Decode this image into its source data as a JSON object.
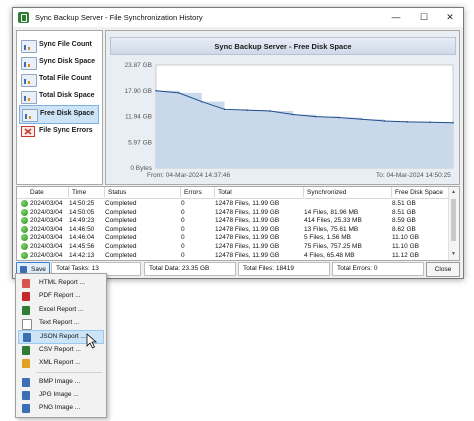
{
  "window": {
    "title": "Sync Backup Server - File Synchronization History",
    "controls": [
      "—",
      "☐",
      "✕"
    ]
  },
  "sidebar": {
    "items": [
      {
        "label": "Sync File Count",
        "icon": "chart-icon",
        "active": false
      },
      {
        "label": "Sync Disk Space",
        "icon": "chart-icon",
        "active": false
      },
      {
        "label": "Total File Count",
        "icon": "chart-icon",
        "active": false
      },
      {
        "label": "Total Disk Space",
        "icon": "chart-icon",
        "active": false
      },
      {
        "label": "Free Disk Space",
        "icon": "chart-icon",
        "active": true
      },
      {
        "label": "File Sync Errors",
        "icon": "error-icon",
        "active": false
      }
    ]
  },
  "chart": {
    "title": "Sync Backup Server - Free Disk Space",
    "from_label": "From: 04-Mar-2024 14:37:46",
    "to_label": "To: 04-Mar-2024 14:50:25"
  },
  "chart_data": {
    "type": "area",
    "title": "Sync Backup Server - Free Disk Space",
    "y_ticks": [
      "23.87 GB",
      "17.90 GB",
      "11.94 GB",
      "5.97 GB",
      "0 Bytes"
    ],
    "ylim": [
      0,
      23.87
    ],
    "x_start": "04-Mar-2024 14:37:46",
    "x_end": "04-Mar-2024 14:50:25",
    "grid": false,
    "values": [
      17.9,
      17.4,
      15.4,
      13.6,
      13.4,
      13.2,
      12.4,
      11.9,
      11.7,
      11.3,
      10.9,
      10.7,
      10.6,
      10.5
    ]
  },
  "table": {
    "columns": [
      "Date",
      "Time",
      "Status",
      "Errors",
      "Total",
      "Synchronized",
      "Free Disk Space"
    ],
    "rows": [
      [
        "2024/03/04",
        "14:50:25",
        "Completed",
        "0",
        "12478 Files, 11.99 GB",
        "",
        "8.51 GB"
      ],
      [
        "2024/03/04",
        "14:50:05",
        "Completed",
        "0",
        "12478 Files, 11.99 GB",
        "14 Files, 81.96 MB",
        "8.51 GB"
      ],
      [
        "2024/03/04",
        "14:49:23",
        "Completed",
        "0",
        "12478 Files, 11.99 GB",
        "414 Files, 25.33 MB",
        "8.59 GB"
      ],
      [
        "2024/03/04",
        "14:46:50",
        "Completed",
        "0",
        "12478 Files, 11.99 GB",
        "13 Files, 75.61 MB",
        "8.62 GB"
      ],
      [
        "2024/03/04",
        "14:46:04",
        "Completed",
        "0",
        "12478 Files, 11.99 GB",
        "5 Files, 1.56 MB",
        "11.10 GB"
      ],
      [
        "2024/03/04",
        "14:45:56",
        "Completed",
        "0",
        "12478 Files, 11.99 GB",
        "75 Files, 757.25 MB",
        "11.10 GB"
      ],
      [
        "2024/03/04",
        "14:42:13",
        "Completed",
        "0",
        "12478 Files, 11.99 GB",
        "4 Files, 65.48 MB",
        "11.12 GB"
      ]
    ]
  },
  "statusbar": {
    "save_label": "Save",
    "total_tasks": "Total Tasks: 13",
    "total_data": "Total Data: 23.35 GB",
    "total_files": "Total Files: 18419",
    "total_errors": "Total Errors: 0",
    "close_label": "Close"
  },
  "menu": {
    "items": [
      {
        "label": "HTML Report ...",
        "color": "#d9534f"
      },
      {
        "label": "PDF Report ...",
        "color": "#c62828"
      },
      {
        "label": "Excel Report ...",
        "color": "#2e7d32"
      },
      {
        "label": "Text Report ...",
        "color": "#6b6b6b"
      },
      {
        "label": "JSON Report ...",
        "color": "#3b6fb6",
        "highlighted": true
      },
      {
        "label": "CSV Report ...",
        "color": "#2e7d32"
      },
      {
        "label": "XML Report ...",
        "color": "#e0a020"
      },
      {
        "label": "BMP Image ...",
        "color": "#3b6fb6"
      },
      {
        "label": "JPG Image ...",
        "color": "#3b6fb6"
      },
      {
        "label": "PNG Image ...",
        "color": "#3b6fb6"
      }
    ]
  },
  "colors": {
    "chart_fill": "#c9d8ea",
    "chart_line": "#1f4e8c",
    "chart_bg": "#ffffff",
    "selection": "#cde3f7"
  }
}
